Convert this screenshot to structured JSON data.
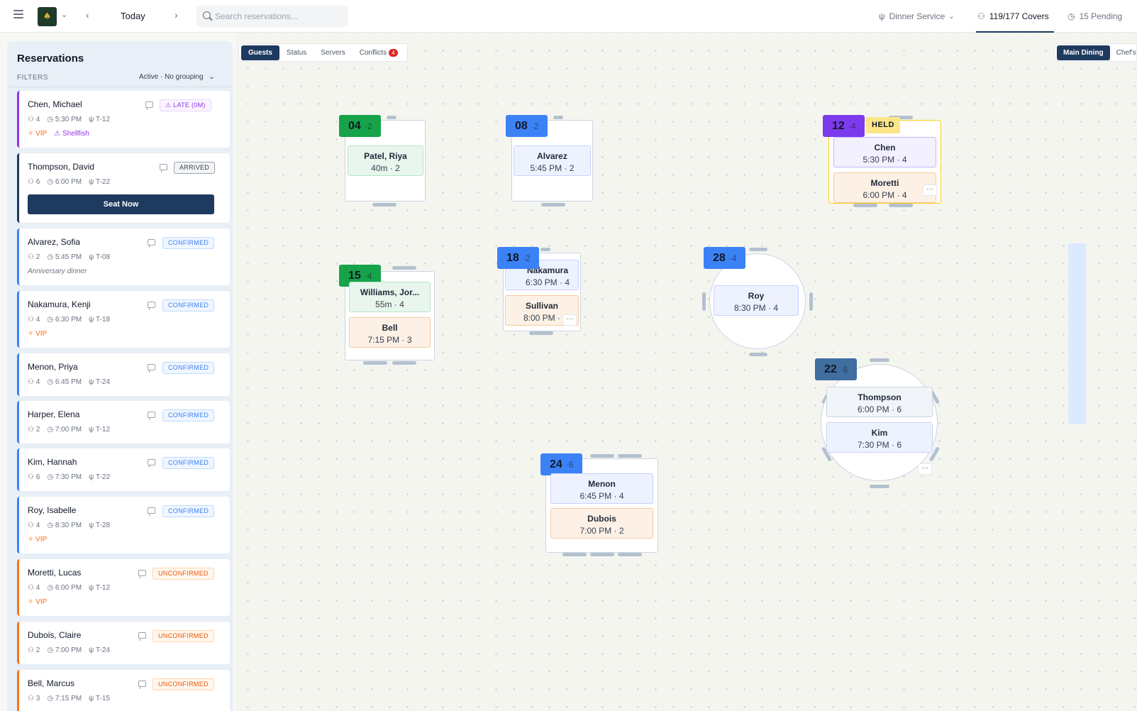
{
  "topbar": {
    "date_label": "Today",
    "search_placeholder": "Search reservations...",
    "service_label": "Dinner Service",
    "covers_label": "119/177 Covers",
    "pending_label": "15 Pending",
    "logo_glyph": "♠",
    "prev_glyph": "‹",
    "next_glyph": "›",
    "chevron_glyph": "⌄"
  },
  "sidebar": {
    "title": "Reservations",
    "filters_label": "FILTERS",
    "grouping_label": "Active · No grouping",
    "reservations": [
      {
        "name": "Chen, Michael",
        "guests": "4",
        "time": "5:30 PM",
        "table": "T-12",
        "status": "LATE (0M)",
        "tags": [
          "VIP",
          "Shellfish"
        ]
      },
      {
        "name": "Thompson, David",
        "guests": "6",
        "time": "6:00 PM",
        "table": "T-22",
        "status": "ARRIVED",
        "action": "Seat Now"
      },
      {
        "name": "Alvarez, Sofia",
        "guests": "2",
        "time": "5:45 PM",
        "table": "T-08",
        "status": "CONFIRMED",
        "note": "Anniversary dinner"
      },
      {
        "name": "Nakamura, Kenji",
        "guests": "4",
        "time": "6:30 PM",
        "table": "T-18",
        "status": "CONFIRMED",
        "tags": [
          "VIP"
        ]
      },
      {
        "name": "Menon, Priya",
        "guests": "4",
        "time": "6:45 PM",
        "table": "T-24",
        "status": "CONFIRMED"
      },
      {
        "name": "Harper, Elena",
        "guests": "2",
        "time": "7:00 PM",
        "table": "T-12",
        "status": "CONFIRMED"
      },
      {
        "name": "Kim, Hannah",
        "guests": "6",
        "time": "7:30 PM",
        "table": "T-22",
        "status": "CONFIRMED"
      },
      {
        "name": "Roy, Isabelle",
        "guests": "4",
        "time": "8:30 PM",
        "table": "T-28",
        "status": "CONFIRMED",
        "tags": [
          "VIP"
        ]
      },
      {
        "name": "Moretti, Lucas",
        "guests": "4",
        "time": "6:00 PM",
        "table": "T-12",
        "status": "UNCONFIRMED",
        "tags": [
          "VIP"
        ]
      },
      {
        "name": "Dubois, Claire",
        "guests": "2",
        "time": "7:00 PM",
        "table": "T-24",
        "status": "UNCONFIRMED"
      },
      {
        "name": "Bell, Marcus",
        "guests": "3",
        "time": "7:15 PM",
        "table": "T-15",
        "status": "UNCONFIRMED"
      }
    ]
  },
  "floor": {
    "tabs": [
      "Guests",
      "Status",
      "Servers",
      "Conflicts"
    ],
    "conflict_count": "4",
    "rooms": [
      "Main Dining",
      "Chef's"
    ],
    "held_label": "HELD",
    "more_glyph": "···",
    "tables": [
      {
        "number": "04",
        "seats": "·2",
        "reservations": [
          {
            "name": "Patel, Riya",
            "detail": "40m · 2"
          }
        ]
      },
      {
        "number": "08",
        "seats": "·2",
        "reservations": [
          {
            "name": "Alvarez",
            "detail": "5:45 PM · 2"
          }
        ]
      },
      {
        "number": "12",
        "seats": "·4",
        "reservations": [
          {
            "name": "Chen",
            "detail": "5:30 PM · 4"
          },
          {
            "name": "Moretti",
            "detail": "6:00 PM · 4"
          }
        ]
      },
      {
        "number": "15",
        "seats": "·4",
        "reservations": [
          {
            "name": "Williams, Jor...",
            "detail": "55m · 4"
          },
          {
            "name": "Bell",
            "detail": "7:15 PM · 3"
          }
        ]
      },
      {
        "number": "18",
        "seats": "·2",
        "reservations": [
          {
            "name": "Nakamura",
            "detail": "6:30 PM · 4"
          },
          {
            "name": "Sullivan",
            "detail": "8:00 PM ·"
          }
        ]
      },
      {
        "number": "28",
        "seats": "·4",
        "reservations": [
          {
            "name": "Roy",
            "detail": "8:30 PM · 4"
          }
        ]
      },
      {
        "number": "22",
        "seats": "·6",
        "reservations": [
          {
            "name": "Thompson",
            "detail": "6:00 PM · 6"
          },
          {
            "name": "Kim",
            "detail": "7:30 PM · 6"
          }
        ]
      },
      {
        "number": "24",
        "seats": "·6",
        "reservations": [
          {
            "name": "Menon",
            "detail": "6:45 PM · 4"
          },
          {
            "name": "Dubois",
            "detail": "7:00 PM · 2"
          }
        ]
      }
    ]
  },
  "icons": {
    "guests": "guests-icon",
    "clock": "clock-icon",
    "table": "fork-knife-icon",
    "vip": "sparkle-icon",
    "allergy": "warning-icon"
  },
  "colors": {
    "navy": "#1e3a5f",
    "confirmed": "#3b82f6",
    "late": "#9333ea",
    "unconfirmed": "#f97316",
    "seated": "#16a34a",
    "held": "#facc15"
  }
}
